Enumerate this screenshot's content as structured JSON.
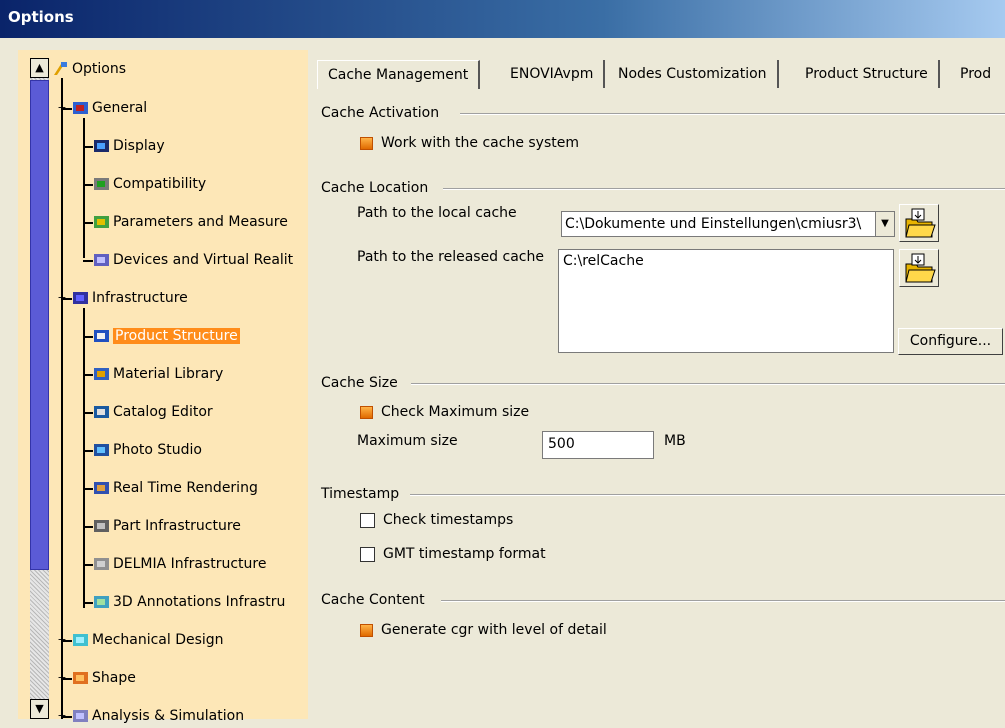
{
  "window": {
    "title": "Options"
  },
  "colors": {
    "title_start": "#0a246a",
    "tree_bg": "#fde7b7",
    "selection": "#ff8c1a",
    "dialog_bg": "#ece9d8"
  },
  "tree": {
    "root": {
      "label": "Options",
      "icon": "options-icon"
    },
    "items": [
      {
        "label": "General",
        "icon": "general-icon",
        "level": 1
      },
      {
        "label": "Display",
        "icon": "display-icon",
        "level": 2
      },
      {
        "label": "Compatibility",
        "icon": "compatibility-icon",
        "level": 2
      },
      {
        "label": "Parameters and Measure",
        "icon": "parameters-icon",
        "level": 2
      },
      {
        "label": "Devices and Virtual Realit",
        "icon": "devices-icon",
        "level": 2
      },
      {
        "label": "Infrastructure",
        "icon": "infrastructure-icon",
        "level": 1
      },
      {
        "label": "Product Structure",
        "icon": "product-structure-icon",
        "level": 2,
        "selected": true
      },
      {
        "label": "Material Library",
        "icon": "material-library-icon",
        "level": 2
      },
      {
        "label": "Catalog Editor",
        "icon": "catalog-editor-icon",
        "level": 2
      },
      {
        "label": "Photo Studio",
        "icon": "photo-studio-icon",
        "level": 2
      },
      {
        "label": "Real Time Rendering",
        "icon": "real-time-rendering-icon",
        "level": 2
      },
      {
        "label": "Part Infrastructure",
        "icon": "part-infrastructure-icon",
        "level": 2
      },
      {
        "label": "DELMIA Infrastructure",
        "icon": "delmia-icon",
        "level": 2
      },
      {
        "label": "3D Annotations Infrastru",
        "icon": "annotations-icon",
        "level": 2
      },
      {
        "label": "Mechanical Design",
        "icon": "mechanical-design-icon",
        "level": 1
      },
      {
        "label": "Shape",
        "icon": "shape-icon",
        "level": 1
      },
      {
        "label": "Analysis & Simulation",
        "icon": "analysis-icon",
        "level": 1
      }
    ]
  },
  "tabs": [
    "Cache Management",
    "ENOVIAvpm",
    "Nodes Customization",
    "Product Structure",
    "Prod"
  ],
  "cache_activation": {
    "title": "Cache Activation",
    "work_with_cache": {
      "label": "Work with the cache system",
      "checked": true
    }
  },
  "cache_location": {
    "title": "Cache Location",
    "local_label": "Path to the local cache",
    "local_value": "C:\\Dokumente und Einstellungen\\cmiusr3\\",
    "released_label": "Path to the released cache",
    "released_value": "C:\\relCache",
    "configure_label": "Configure..."
  },
  "cache_size": {
    "title": "Cache Size",
    "check_max": {
      "label": "Check Maximum size",
      "checked": true
    },
    "max_label": "Maximum size",
    "max_value": "500",
    "unit": "MB"
  },
  "timestamp": {
    "title": "Timestamp",
    "check_timestamps": {
      "label": "Check timestamps",
      "checked": false
    },
    "gmt_format": {
      "label": "GMT timestamp format",
      "checked": false
    }
  },
  "cache_content": {
    "title": "Cache Content",
    "generate_cgr": {
      "label": "Generate cgr with level of detail",
      "checked": true
    }
  }
}
